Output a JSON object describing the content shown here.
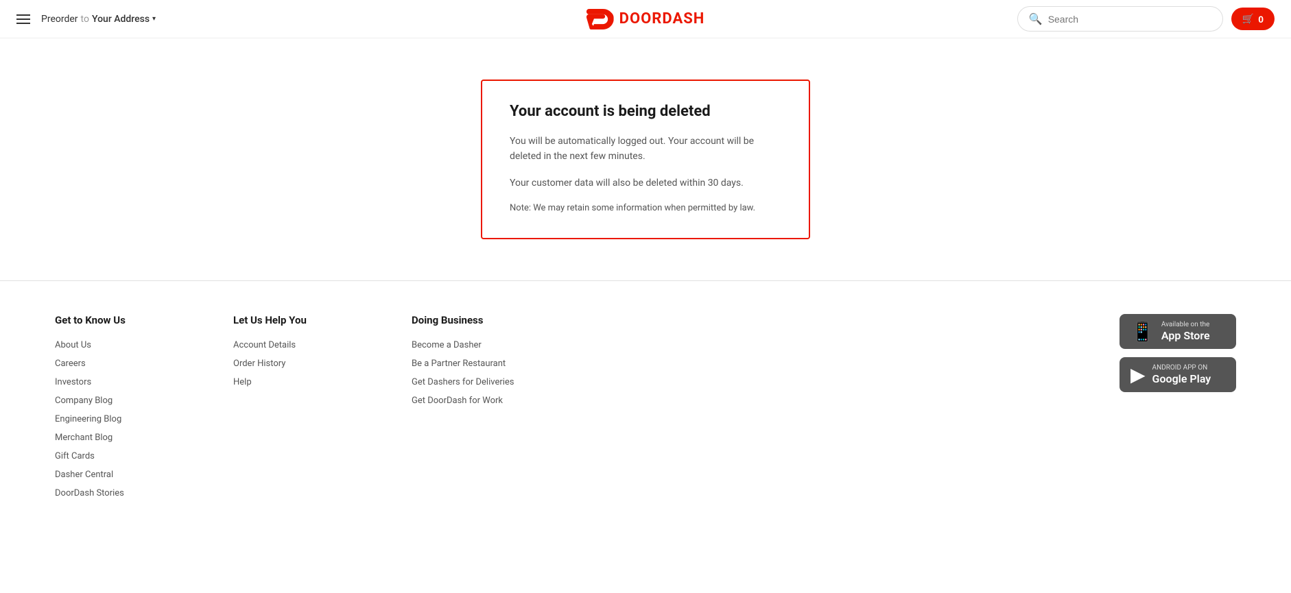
{
  "header": {
    "menu_icon_label": "Menu",
    "preorder_label": "Preorder",
    "to_word": "to",
    "address_label": "Your Address",
    "logo_text": "DOORDASH",
    "search_placeholder": "Search",
    "cart_count": "0"
  },
  "main": {
    "box_title": "Your account is being deleted",
    "box_text1": "You will be automatically logged out. Your account will be deleted in the next few minutes.",
    "box_text2": "Your customer data will also be deleted within 30 days.",
    "box_note": "Note: We may retain some information when permitted by law."
  },
  "footer": {
    "columns": [
      {
        "title": "Get to Know Us",
        "links": [
          "About Us",
          "Careers",
          "Investors",
          "Company Blog",
          "Engineering Blog",
          "Merchant Blog",
          "Gift Cards",
          "Dasher Central",
          "DoorDash Stories"
        ]
      },
      {
        "title": "Let Us Help You",
        "links": [
          "Account Details",
          "Order History",
          "Help"
        ]
      },
      {
        "title": "Doing Business",
        "links": [
          "Become a Dasher",
          "Be a Partner Restaurant",
          "Get Dashers for Deliveries",
          "Get DoorDash for Work"
        ]
      }
    ],
    "app_store": {
      "label_small": "Available on the",
      "label_large": "App Store"
    },
    "google_play": {
      "label_small": "ANDROID APP ON",
      "label_large": "Google Play"
    }
  }
}
